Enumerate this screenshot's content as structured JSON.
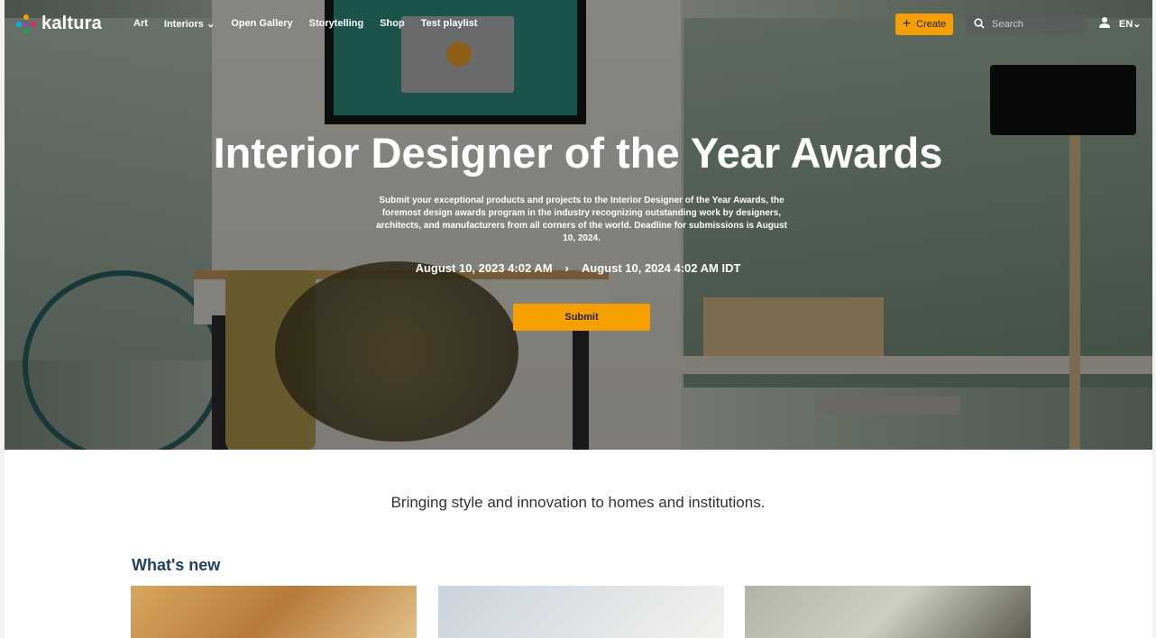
{
  "brand": {
    "name": "kaltura"
  },
  "nav": {
    "items": [
      {
        "label": "Art"
      },
      {
        "label": "Interiors ⌄"
      },
      {
        "label": "Open Gallery"
      },
      {
        "label": "Storytelling"
      },
      {
        "label": "Shop"
      },
      {
        "label": "Test playlist"
      }
    ],
    "create_label": "Create",
    "search_placeholder": "Search",
    "language": "EN"
  },
  "hero": {
    "title": "Interior Designer of the Year Awards",
    "description": "Submit your exceptional products and projects to the Interior Designer of the Year Awards, the foremost design awards program in the industry recognizing outstanding work by designers, architects, and manufacturers from all corners of the world. Deadline for submissions is August 10, 2024.",
    "start_date": "August 10, 2023 4:02 AM",
    "date_separator": "›",
    "end_date": "August 10, 2024 4:02 AM IDT",
    "submit_label": "Submit"
  },
  "main": {
    "tagline": "Bringing style and innovation to homes and institutions.",
    "whats_new_title": "What's new"
  },
  "colors": {
    "accent": "#f5a000",
    "section_title": "#1e3f5e"
  },
  "icons": {
    "create": "plus-icon",
    "search": "search-icon",
    "user": "user-icon",
    "language": "chevron-down-icon"
  }
}
